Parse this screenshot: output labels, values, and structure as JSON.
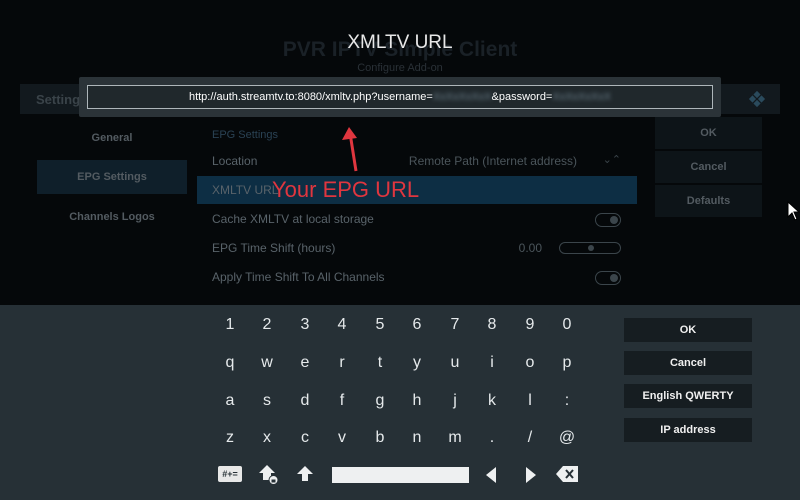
{
  "background": {
    "addon_title": "PVR IPTV Simple Client",
    "addon_subtitle": "Configure Add-on",
    "header_label": "Settings",
    "sidebar": [
      {
        "label": "General"
      },
      {
        "label": "EPG Settings",
        "active": true
      },
      {
        "label": "Channels Logos"
      }
    ],
    "section_label": "EPG Settings",
    "rows": [
      {
        "label": "Location",
        "value": "Remote Path (Internet address)"
      },
      {
        "label": "XMLTV URL",
        "value": ""
      },
      {
        "label": "Cache XMLTV at local storage",
        "value": ""
      },
      {
        "label": "EPG Time Shift (hours)",
        "value": "0.00"
      },
      {
        "label": "Apply Time Shift To All Channels",
        "value": ""
      }
    ],
    "right_buttons": [
      "OK",
      "Cancel",
      "Defaults"
    ]
  },
  "dialog": {
    "title": "XMLTV URL",
    "url_prefix": "http://auth.streamtv.to:8080/xmltv.php?username=",
    "url_username": "XxXxXxXxX",
    "url_middle": "&password=",
    "url_password": "XxXxXxXxX"
  },
  "annotation": {
    "text": "Your EPG URL",
    "color": "#e0363f"
  },
  "keyboard": {
    "rows": [
      [
        "1",
        "2",
        "3",
        "4",
        "5",
        "6",
        "7",
        "8",
        "9",
        "0"
      ],
      [
        "q",
        "w",
        "e",
        "r",
        "t",
        "y",
        "u",
        "i",
        "o",
        "p"
      ],
      [
        "a",
        "s",
        "d",
        "f",
        "g",
        "h",
        "j",
        "k",
        "l",
        ":"
      ],
      [
        "z",
        "x",
        "c",
        "v",
        "b",
        "n",
        "m",
        ".",
        "/",
        "@"
      ]
    ],
    "symbols_key": "#+=",
    "buttons": [
      "OK",
      "Cancel",
      "English QWERTY",
      "IP address"
    ],
    "bottom_icons": [
      "symbols-key",
      "caps-lock-icon",
      "shift-icon",
      "space-key",
      "left-arrow-icon",
      "right-arrow-icon",
      "backspace-icon"
    ]
  },
  "colors": {
    "keyboard_bg": "#263036",
    "button_bg": "#161d21",
    "accent_highlight": "#0d2e44"
  }
}
